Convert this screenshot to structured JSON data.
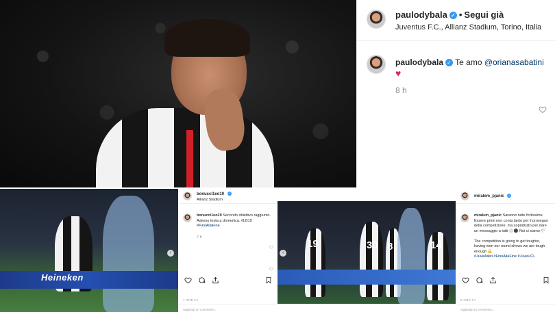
{
  "main_post": {
    "header": {
      "username": "paulodybala",
      "follow_label": "Segui già",
      "location": "Juventus F.C., Allianz Stadium, Torino, Italia"
    },
    "comment": {
      "username": "paulodybala",
      "text": "Te amo ",
      "mention": "@orianasabatini",
      "emoji": "♥",
      "time": "8 h"
    }
  },
  "left_post": {
    "header": {
      "username": "bonucci1eo19",
      "location": "Allianz Stadium"
    },
    "comment": {
      "username": "bonucci1eo19",
      "text": "Secondo obiettivo raggiunto. Adesso testa a domenica. ",
      "hashtags": "#LB19 #FinoAllaFine",
      "time": "7 h"
    },
    "date": "7 ORE FA",
    "add_comment": "Aggiungi un commento...",
    "photo_ad": "Heineken"
  },
  "right_post": {
    "header": {
      "username": "miralem_pjanic"
    },
    "comment": {
      "username": "miralem_pjanic",
      "text": "Saranno tutte fortissime. Essere primi non conta tanto per il proseguo della competizione, ma soprattutto per dare un messaggio a tutti ⚪⚫ Noi ci siamo 🏳",
      "text_en": "The competition is going to get tougher, having won our round shows we are tough enough 💪",
      "hashtags": "#JuveAtleti #FinoAllaFine #JuveUCL"
    },
    "date": "8 ORE FA",
    "add_comment": "Aggiungi un commento..."
  },
  "jersey_numbers": [
    "19",
    "30",
    "8",
    "14"
  ]
}
